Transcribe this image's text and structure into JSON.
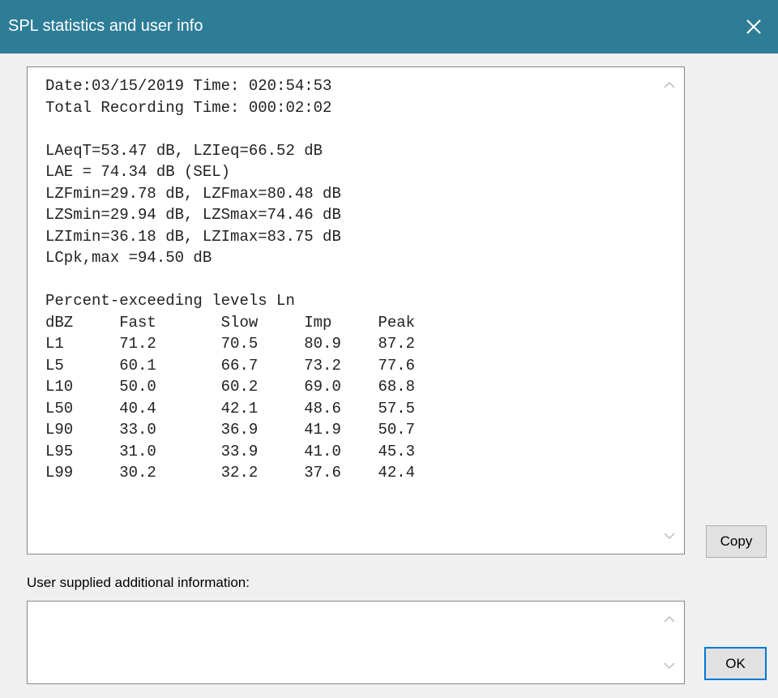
{
  "window": {
    "title": "SPL statistics and user info",
    "close_icon": "close-icon",
    "title_bar_color": "#2e7d97"
  },
  "stats": {
    "lines": [
      "Date:03/15/2019 Time: 020:54:53",
      "Total Recording Time: 000:02:02",
      "",
      "LAeqT=53.47 dB, LZIeq=66.52 dB",
      "LAE = 74.34 dB (SEL)",
      "LZFmin=29.78 dB, LZFmax=80.48 dB",
      "LZSmin=29.94 dB, LZSmax=74.46 dB",
      "LZImin=36.18 dB, LZImax=83.75 dB",
      "LCpk,max =94.50 dB",
      "",
      "Percent-exceeding levels Ln",
      "dBZ     Fast       Slow     Imp     Peak",
      "L1      71.2       70.5     80.9    87.2",
      "L5      60.1       66.7     73.2    77.6",
      "L10     50.0       60.2     69.0    68.8",
      "L50     40.4       42.1     48.6    57.5",
      "L90     33.0       36.9     41.9    50.7",
      "L95     31.0       33.9     41.0    45.3",
      "L99     30.2       32.2     37.6    42.4"
    ]
  },
  "buttons": {
    "copy_label": "Copy",
    "ok_label": "OK"
  },
  "user_info": {
    "label": "User supplied additional information:",
    "value": ""
  }
}
